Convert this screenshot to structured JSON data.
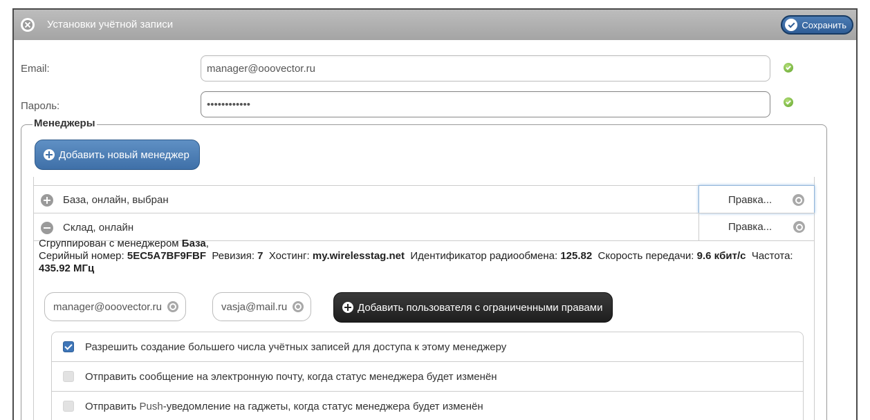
{
  "window": {
    "title": "Установки учётной записи",
    "save_label": "Сохранить"
  },
  "fields": {
    "email_label": "Email:",
    "email_value": "manager@ooovector.ru",
    "password_label": "Пароль:",
    "password_value": "••••••••••••"
  },
  "managers": {
    "legend": "Менеджеры",
    "add_button": "Добавить новый менеджер",
    "rows": [
      {
        "name": "База, онлайн, выбран",
        "edit": "Правка...",
        "expanded": false
      },
      {
        "name": "Склад, онлайн",
        "edit": "Правка...",
        "expanded": true
      }
    ],
    "details": {
      "grouped_prefix": "Сгруппирован с менеджером ",
      "grouped_name": "База",
      "grouped_suffix": ",",
      "serial_label": "Серийный номер: ",
      "serial_value": "5EC5A7BF9FBF",
      "revision_label": "Ревизия: ",
      "revision_value": "7",
      "hosting_label": "Хостинг: ",
      "hosting_value": "my.wirelesstag.net",
      "radio_label": "Идентификатор радиообмена: ",
      "radio_value": "125.82",
      "speed_label": "Скорость передачи: ",
      "speed_value": "9.6 кбит/с",
      "freq_label": "Частота: ",
      "freq_value": "435.92 МГц"
    },
    "users": [
      "manager@ooovector.ru",
      "vasja@mail.ru"
    ],
    "add_restricted_button": "Добавить пользователя с ограниченными правами",
    "options": [
      {
        "label": "Разрешить создание большего числа учётных записей для доступа к этому менеджеру",
        "checked": true
      },
      {
        "label": "Отправить сообщение на электронную почту, когда статус менеджера будет изменён",
        "checked": false
      },
      {
        "label_pre": "Отправить ",
        "label_hl": "Push",
        "label_post": "-уведомление на гаджеты, когда статус менеджера будет изменён",
        "checked": false
      }
    ]
  },
  "colors": {
    "titlebar": "#a8a8a8",
    "save_button": "#2f5d96",
    "add_button": "#4f80b6",
    "restricted_button": "#222222",
    "checkbox_on": "#3f76b8",
    "ok_green": "#5ea22a"
  }
}
